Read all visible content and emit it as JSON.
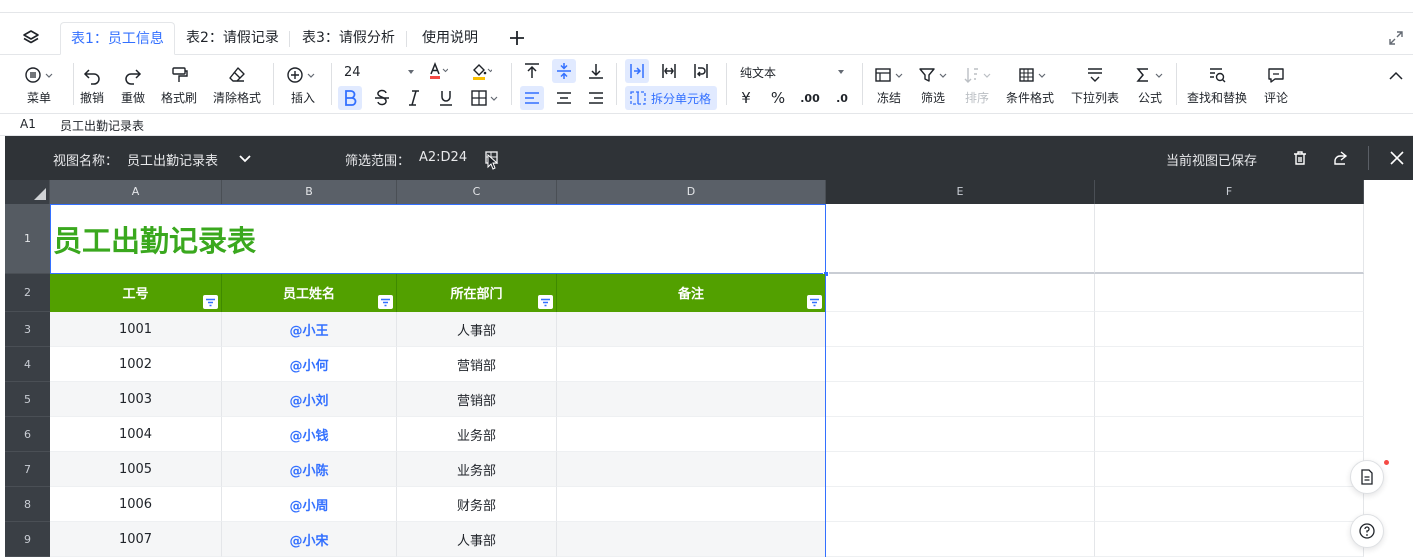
{
  "tabs": [
    {
      "label": "表1：员工信息",
      "active": true
    },
    {
      "label": "表2：请假记录",
      "active": false
    },
    {
      "label": "表3：请假分析",
      "active": false
    },
    {
      "label": "使用说明",
      "active": false
    }
  ],
  "toolbar": {
    "menu": "菜单",
    "undo": "撤销",
    "redo": "重做",
    "format_painter": "格式刷",
    "clear_format": "清除格式",
    "insert": "插入",
    "font_size": "24",
    "merge_label": "拆分单元格",
    "number_format": "纯文本",
    "currency_symbol": "¥",
    "percent_symbol": "%",
    "decimal_inc": ".00",
    "decimal_dec": ".0",
    "freeze": "冻结",
    "filter": "筛选",
    "sort": "排序",
    "conditional_format": "条件格式",
    "dropdown_list": "下拉列表",
    "formula": "公式",
    "find_replace": "查找和替换",
    "comment": "评论"
  },
  "formula_bar": {
    "cell_ref": "A1",
    "value": "员工出勤记录表"
  },
  "view_bar": {
    "name_label": "视图名称：",
    "name_value": "员工出勤记录表",
    "range_label": "筛选范围：",
    "range_value": "A2:D24",
    "saved_status": "当前视图已保存"
  },
  "columns": [
    "A",
    "B",
    "C",
    "D",
    "E",
    "F"
  ],
  "row_numbers": [
    "1",
    "2",
    "3",
    "4",
    "5",
    "6",
    "7",
    "8",
    "9"
  ],
  "sheet": {
    "title": "员工出勤记录表",
    "headers": [
      "工号",
      "员工姓名",
      "所在部门",
      "备注"
    ],
    "rows": [
      {
        "id": "1001",
        "name": "@小王",
        "dept": "人事部",
        "note": ""
      },
      {
        "id": "1002",
        "name": "@小何",
        "dept": "营销部",
        "note": ""
      },
      {
        "id": "1003",
        "name": "@小刘",
        "dept": "营销部",
        "note": ""
      },
      {
        "id": "1004",
        "name": "@小钱",
        "dept": "业务部",
        "note": ""
      },
      {
        "id": "1005",
        "name": "@小陈",
        "dept": "业务部",
        "note": ""
      },
      {
        "id": "1006",
        "name": "@小周",
        "dept": "财务部",
        "note": ""
      },
      {
        "id": "1007",
        "name": "@小宋",
        "dept": "人事部",
        "note": ""
      }
    ]
  },
  "colors": {
    "accent": "#3370ff",
    "header_fill": "#52a000",
    "title_text": "#3aa81e",
    "view_bar_bg": "#2f3337",
    "notification_dot": "#f54a45"
  }
}
